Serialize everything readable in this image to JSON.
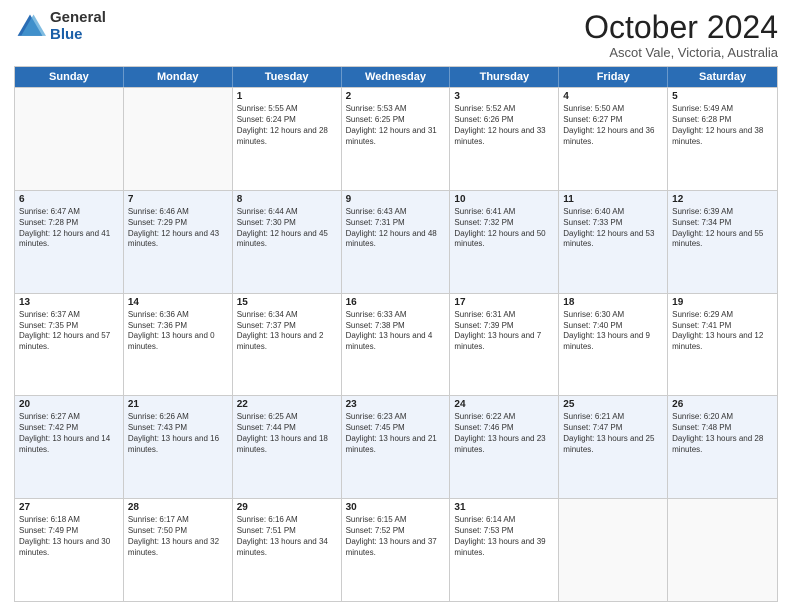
{
  "logo": {
    "general": "General",
    "blue": "Blue"
  },
  "header": {
    "month": "October 2024",
    "location": "Ascot Vale, Victoria, Australia"
  },
  "days": [
    "Sunday",
    "Monday",
    "Tuesday",
    "Wednesday",
    "Thursday",
    "Friday",
    "Saturday"
  ],
  "weeks": [
    [
      {
        "day": "",
        "empty": true
      },
      {
        "day": "",
        "empty": true
      },
      {
        "day": "1",
        "sunrise": "Sunrise: 5:55 AM",
        "sunset": "Sunset: 6:24 PM",
        "daylight": "Daylight: 12 hours and 28 minutes."
      },
      {
        "day": "2",
        "sunrise": "Sunrise: 5:53 AM",
        "sunset": "Sunset: 6:25 PM",
        "daylight": "Daylight: 12 hours and 31 minutes."
      },
      {
        "day": "3",
        "sunrise": "Sunrise: 5:52 AM",
        "sunset": "Sunset: 6:26 PM",
        "daylight": "Daylight: 12 hours and 33 minutes."
      },
      {
        "day": "4",
        "sunrise": "Sunrise: 5:50 AM",
        "sunset": "Sunset: 6:27 PM",
        "daylight": "Daylight: 12 hours and 36 minutes."
      },
      {
        "day": "5",
        "sunrise": "Sunrise: 5:49 AM",
        "sunset": "Sunset: 6:28 PM",
        "daylight": "Daylight: 12 hours and 38 minutes."
      }
    ],
    [
      {
        "day": "6",
        "sunrise": "Sunrise: 6:47 AM",
        "sunset": "Sunset: 7:28 PM",
        "daylight": "Daylight: 12 hours and 41 minutes."
      },
      {
        "day": "7",
        "sunrise": "Sunrise: 6:46 AM",
        "sunset": "Sunset: 7:29 PM",
        "daylight": "Daylight: 12 hours and 43 minutes."
      },
      {
        "day": "8",
        "sunrise": "Sunrise: 6:44 AM",
        "sunset": "Sunset: 7:30 PM",
        "daylight": "Daylight: 12 hours and 45 minutes."
      },
      {
        "day": "9",
        "sunrise": "Sunrise: 6:43 AM",
        "sunset": "Sunset: 7:31 PM",
        "daylight": "Daylight: 12 hours and 48 minutes."
      },
      {
        "day": "10",
        "sunrise": "Sunrise: 6:41 AM",
        "sunset": "Sunset: 7:32 PM",
        "daylight": "Daylight: 12 hours and 50 minutes."
      },
      {
        "day": "11",
        "sunrise": "Sunrise: 6:40 AM",
        "sunset": "Sunset: 7:33 PM",
        "daylight": "Daylight: 12 hours and 53 minutes."
      },
      {
        "day": "12",
        "sunrise": "Sunrise: 6:39 AM",
        "sunset": "Sunset: 7:34 PM",
        "daylight": "Daylight: 12 hours and 55 minutes."
      }
    ],
    [
      {
        "day": "13",
        "sunrise": "Sunrise: 6:37 AM",
        "sunset": "Sunset: 7:35 PM",
        "daylight": "Daylight: 12 hours and 57 minutes."
      },
      {
        "day": "14",
        "sunrise": "Sunrise: 6:36 AM",
        "sunset": "Sunset: 7:36 PM",
        "daylight": "Daylight: 13 hours and 0 minutes."
      },
      {
        "day": "15",
        "sunrise": "Sunrise: 6:34 AM",
        "sunset": "Sunset: 7:37 PM",
        "daylight": "Daylight: 13 hours and 2 minutes."
      },
      {
        "day": "16",
        "sunrise": "Sunrise: 6:33 AM",
        "sunset": "Sunset: 7:38 PM",
        "daylight": "Daylight: 13 hours and 4 minutes."
      },
      {
        "day": "17",
        "sunrise": "Sunrise: 6:31 AM",
        "sunset": "Sunset: 7:39 PM",
        "daylight": "Daylight: 13 hours and 7 minutes."
      },
      {
        "day": "18",
        "sunrise": "Sunrise: 6:30 AM",
        "sunset": "Sunset: 7:40 PM",
        "daylight": "Daylight: 13 hours and 9 minutes."
      },
      {
        "day": "19",
        "sunrise": "Sunrise: 6:29 AM",
        "sunset": "Sunset: 7:41 PM",
        "daylight": "Daylight: 13 hours and 12 minutes."
      }
    ],
    [
      {
        "day": "20",
        "sunrise": "Sunrise: 6:27 AM",
        "sunset": "Sunset: 7:42 PM",
        "daylight": "Daylight: 13 hours and 14 minutes."
      },
      {
        "day": "21",
        "sunrise": "Sunrise: 6:26 AM",
        "sunset": "Sunset: 7:43 PM",
        "daylight": "Daylight: 13 hours and 16 minutes."
      },
      {
        "day": "22",
        "sunrise": "Sunrise: 6:25 AM",
        "sunset": "Sunset: 7:44 PM",
        "daylight": "Daylight: 13 hours and 18 minutes."
      },
      {
        "day": "23",
        "sunrise": "Sunrise: 6:23 AM",
        "sunset": "Sunset: 7:45 PM",
        "daylight": "Daylight: 13 hours and 21 minutes."
      },
      {
        "day": "24",
        "sunrise": "Sunrise: 6:22 AM",
        "sunset": "Sunset: 7:46 PM",
        "daylight": "Daylight: 13 hours and 23 minutes."
      },
      {
        "day": "25",
        "sunrise": "Sunrise: 6:21 AM",
        "sunset": "Sunset: 7:47 PM",
        "daylight": "Daylight: 13 hours and 25 minutes."
      },
      {
        "day": "26",
        "sunrise": "Sunrise: 6:20 AM",
        "sunset": "Sunset: 7:48 PM",
        "daylight": "Daylight: 13 hours and 28 minutes."
      }
    ],
    [
      {
        "day": "27",
        "sunrise": "Sunrise: 6:18 AM",
        "sunset": "Sunset: 7:49 PM",
        "daylight": "Daylight: 13 hours and 30 minutes."
      },
      {
        "day": "28",
        "sunrise": "Sunrise: 6:17 AM",
        "sunset": "Sunset: 7:50 PM",
        "daylight": "Daylight: 13 hours and 32 minutes."
      },
      {
        "day": "29",
        "sunrise": "Sunrise: 6:16 AM",
        "sunset": "Sunset: 7:51 PM",
        "daylight": "Daylight: 13 hours and 34 minutes."
      },
      {
        "day": "30",
        "sunrise": "Sunrise: 6:15 AM",
        "sunset": "Sunset: 7:52 PM",
        "daylight": "Daylight: 13 hours and 37 minutes."
      },
      {
        "day": "31",
        "sunrise": "Sunrise: 6:14 AM",
        "sunset": "Sunset: 7:53 PM",
        "daylight": "Daylight: 13 hours and 39 minutes."
      },
      {
        "day": "",
        "empty": true
      },
      {
        "day": "",
        "empty": true
      }
    ]
  ]
}
